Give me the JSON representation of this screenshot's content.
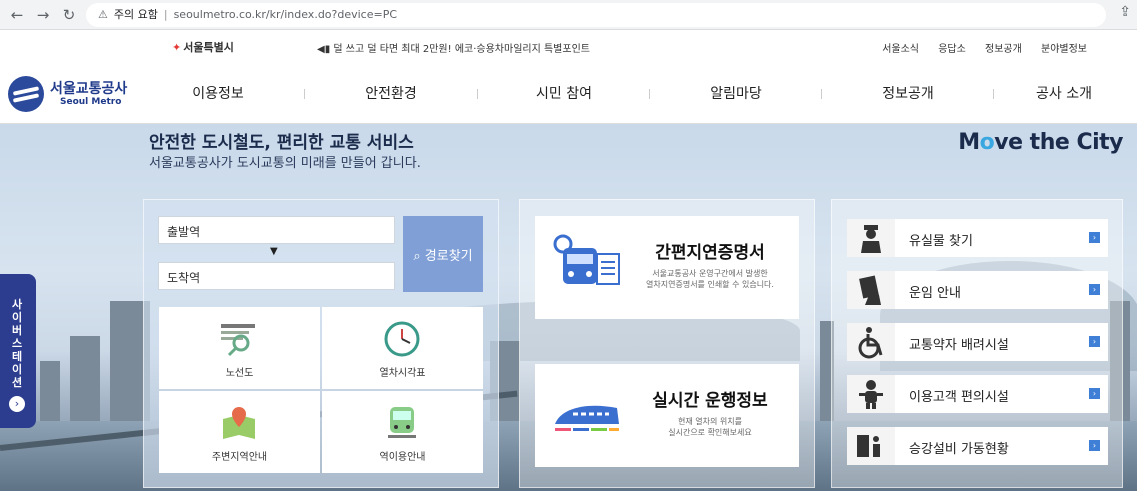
{
  "browser": {
    "back": "←",
    "forward": "→",
    "reload": "↻",
    "security_label": "주의 요함",
    "url": "seoulmetro.co.kr/kr/index.do?device=PC",
    "share": "⇪"
  },
  "utility": {
    "city_logo": "서울특별시",
    "notice": "덜 쓰고 덜 타면 최대 2만원! 에코·승용차마일리지 특별포인트",
    "links": [
      "서울소식",
      "응답소",
      "정보공개",
      "분야별정보"
    ]
  },
  "header": {
    "logo_ko": "서울교통공사",
    "logo_en": "Seoul Metro",
    "nav": [
      "이용정보",
      "안전환경",
      "시민 참여",
      "알림마당",
      "정보공개",
      "공사 소개"
    ]
  },
  "hero": {
    "title": "안전한 도시철도, 편리한 교통 서비스",
    "subtitle": "서울교통공사가 도시교통의 미래를 만들어 갑니다.",
    "slogan_m": "M",
    "slogan_o": "o",
    "slogan_rest": "ve the City"
  },
  "side_tab": {
    "label": "사이버스테이션",
    "arrow": "›"
  },
  "route": {
    "departure": "출발역",
    "arrival": "도착역",
    "arrow": "▼",
    "search_button": "경로찾기"
  },
  "quick_links": [
    "노선도",
    "열차시각표",
    "주변지역안내",
    "역이용안내"
  ],
  "cards": [
    {
      "title": "간편지연증명서",
      "desc1": "서울교통공사 운영구간에서 발생한",
      "desc2": "열차지연증명서를 인쇄할 수 있습니다."
    },
    {
      "title": "실시간 운행정보",
      "desc1": "현재 열차의 위치를",
      "desc2": "실시간으로 확인해보세요"
    }
  ],
  "services": [
    "유실물 찾기",
    "운임 안내",
    "교통약자 배려시설",
    "이용고객 편의시설",
    "승강설비 가동현황"
  ],
  "colors": {
    "brand": "#2c4a9c",
    "side_tab": "#2c3d8f",
    "route_button": "#7f9fd6",
    "go_button": "#3f7fd6"
  }
}
